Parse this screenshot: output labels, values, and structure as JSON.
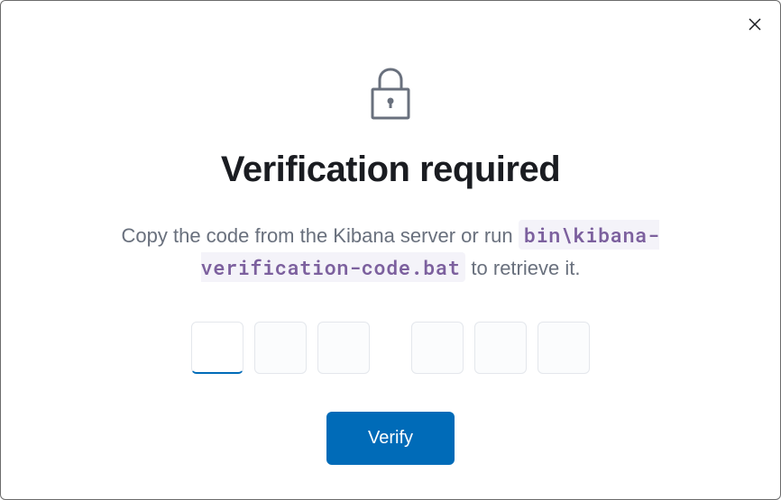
{
  "modal": {
    "title": "Verification required",
    "description_prefix": "Copy the code from the Kibana server or run ",
    "description_code": "bin\\kibana-verification-code.bat",
    "description_suffix": " to retrieve it.",
    "verify_button_label": "Verify",
    "code_inputs": {
      "count": 6,
      "values": [
        "",
        "",
        "",
        "",
        "",
        ""
      ]
    }
  }
}
